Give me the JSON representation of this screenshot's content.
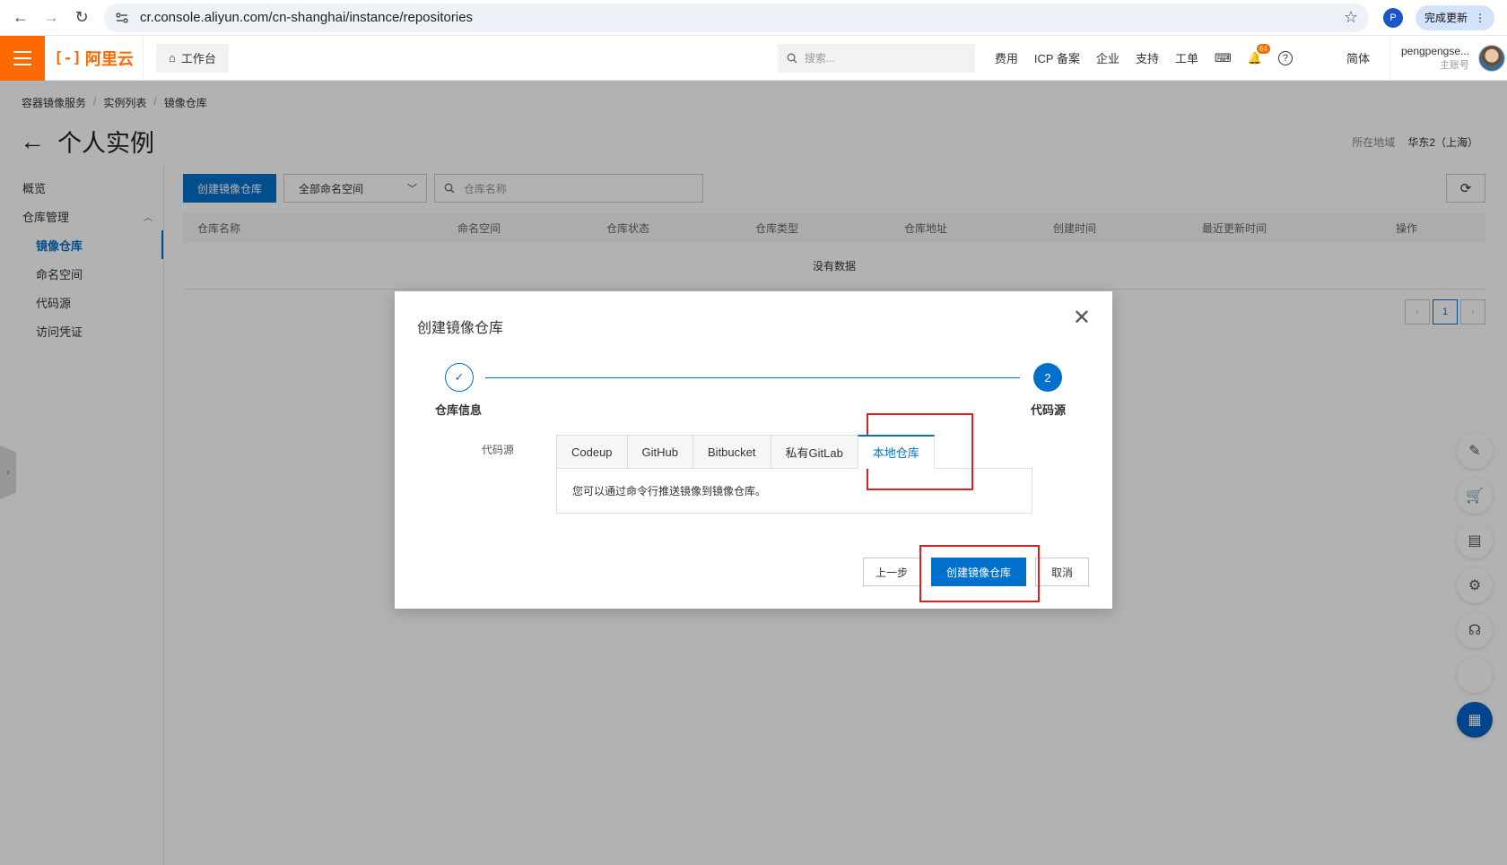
{
  "browser": {
    "url": "cr.console.aliyun.com/cn-shanghai/instance/repositories",
    "profile_initial": "P",
    "update_label": "完成更新"
  },
  "topbar": {
    "logo_text": "阿里云",
    "workbench": "工作台",
    "search_placeholder": "搜索...",
    "links": [
      "费用",
      "ICP 备案",
      "企业",
      "支持",
      "工单"
    ],
    "notification_count": "64",
    "language": "简体",
    "username": "pengpengse...",
    "account_role": "主账号"
  },
  "breadcrumb": [
    "容器镜像服务",
    "实例列表",
    "镜像仓库"
  ],
  "page_title": "个人实例",
  "region": {
    "label": "所在地域",
    "value": "华东2（上海）"
  },
  "sidebar": {
    "overview": "概览",
    "group": "仓库管理",
    "items": [
      "镜像仓库",
      "命名空间",
      "代码源",
      "访问凭证"
    ]
  },
  "toolbar": {
    "create_button": "创建镜像仓库",
    "namespace_select": "全部命名空间",
    "search_placeholder": "仓库名称"
  },
  "table": {
    "columns": [
      "仓库名称",
      "命名空间",
      "仓库状态",
      "仓库类型",
      "仓库地址",
      "创建时间",
      "最近更新时间",
      "操作"
    ],
    "empty_text": "没有数据"
  },
  "pagination": {
    "current": "1"
  },
  "dialog": {
    "title": "创建镜像仓库",
    "steps": [
      {
        "number": "✓",
        "label": "仓库信息"
      },
      {
        "number": "2",
        "label": "代码源"
      }
    ],
    "field_label": "代码源",
    "tabs": [
      "Codeup",
      "GitHub",
      "Bitbucket",
      "私有GitLab",
      "本地仓库"
    ],
    "active_tab": "本地仓库",
    "panel_text": "您可以通过命令行推送镜像到镜像仓库。",
    "buttons": {
      "prev": "上一步",
      "create": "创建镜像仓库",
      "cancel": "取消"
    }
  },
  "colors": {
    "primary": "#0070cc",
    "brand": "#ff6a00",
    "highlight": "#e02020"
  }
}
